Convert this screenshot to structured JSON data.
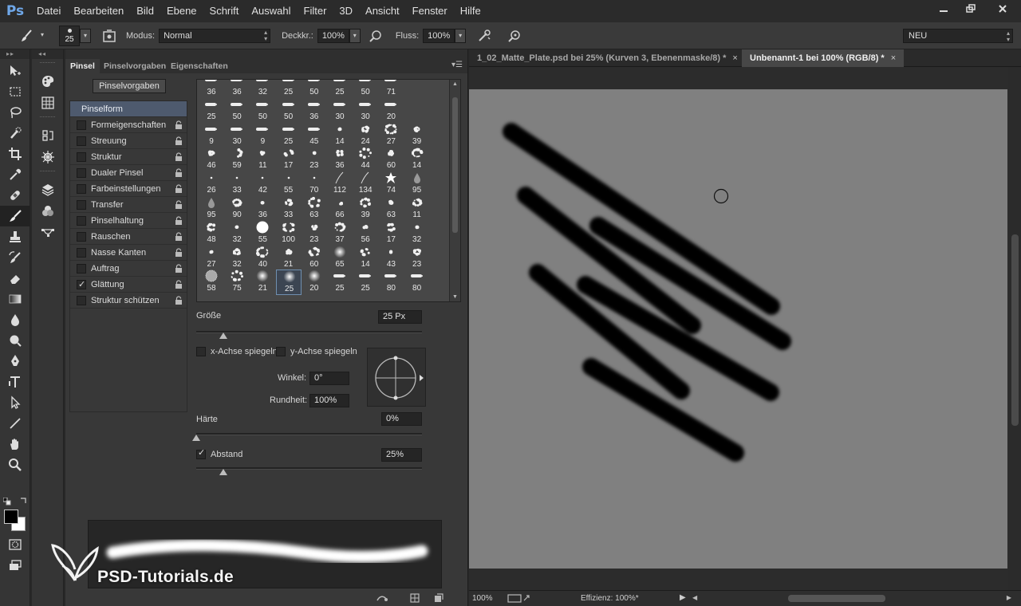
{
  "app": {
    "logo": "Ps"
  },
  "menu": [
    "Datei",
    "Bearbeiten",
    "Bild",
    "Ebene",
    "Schrift",
    "Auswahl",
    "Filter",
    "3D",
    "Ansicht",
    "Fenster",
    "Hilfe"
  ],
  "options": {
    "brush_size": "25",
    "mode_label": "Modus:",
    "mode_value": "Normal",
    "opacity_label": "Deckkr.:",
    "opacity_value": "100%",
    "flow_label": "Fluss:",
    "flow_value": "100%",
    "workspace": "NEU"
  },
  "panel": {
    "tabs": [
      "Pinsel",
      "Pinselvorgaben",
      "Eigenschaften"
    ],
    "presets_button": "Pinselvorgaben",
    "categories": [
      {
        "label": "Pinselform",
        "checked": false,
        "header": true
      },
      {
        "label": "Formeigenschaften",
        "checked": false
      },
      {
        "label": "Streuung",
        "checked": false
      },
      {
        "label": "Struktur",
        "checked": false
      },
      {
        "label": "Dualer Pinsel",
        "checked": false
      },
      {
        "label": "Farbeinstellungen",
        "checked": false
      },
      {
        "label": "Transfer",
        "checked": false
      },
      {
        "label": "Pinselhaltung",
        "checked": false
      },
      {
        "label": "Rauschen",
        "checked": false
      },
      {
        "label": "Nasse Kanten",
        "checked": false
      },
      {
        "label": "Auftrag",
        "checked": false
      },
      {
        "label": "Glättung",
        "checked": true
      },
      {
        "label": "Struktur schützen",
        "checked": false
      }
    ],
    "brush_rows": [
      [
        "36",
        "36",
        "32",
        "25",
        "50",
        "25",
        "50",
        "71"
      ],
      [
        "25",
        "50",
        "50",
        "50",
        "36",
        "30",
        "30",
        "20"
      ],
      [
        "9",
        "30",
        "9",
        "25",
        "45",
        "14",
        "24",
        "27",
        "39"
      ],
      [
        "46",
        "59",
        "11",
        "17",
        "23",
        "36",
        "44",
        "60",
        "14"
      ],
      [
        "26",
        "33",
        "42",
        "55",
        "70",
        "112",
        "134",
        "74",
        "95"
      ],
      [
        "95",
        "90",
        "36",
        "33",
        "63",
        "66",
        "39",
        "63",
        "11"
      ],
      [
        "48",
        "32",
        "55",
        "100",
        "23",
        "37",
        "56",
        "17",
        "32"
      ],
      [
        "27",
        "32",
        "40",
        "21",
        "60",
        "65",
        "14",
        "43",
        "23"
      ],
      [
        "58",
        "75",
        "21",
        "25",
        "20",
        "25",
        "25",
        "80",
        "80"
      ]
    ],
    "size_label": "Größe",
    "size_value": "25 Px",
    "flip_x_label": "x-Achse spiegeln",
    "flip_y_label": "y-Achse spiegeln",
    "angle_label": "Winkel:",
    "angle_value": "0°",
    "roundness_label": "Rundheit:",
    "roundness_value": "100%",
    "hardness_label": "Härte",
    "hardness_value": "0%",
    "spacing_label": "Abstand",
    "spacing_value": "25%",
    "spacing_checked": true,
    "size_fraction": 0.12,
    "hardness_fraction": 0.0,
    "spacing_fraction": 0.12
  },
  "documents": {
    "tabs": [
      {
        "label": "1_02_Matte_Plate.psd bei 25% (Kurven 3, Ebenenmaske/8) *",
        "active": false
      },
      {
        "label": "Unbenannt-1 bei 100% (RGB/8) *",
        "active": true
      }
    ],
    "close_glyph": "×"
  },
  "status": {
    "zoom": "100%",
    "efficiency": "Effizienz: 100%*"
  },
  "watermark": {
    "text": "PSD-Tutorials.de"
  }
}
